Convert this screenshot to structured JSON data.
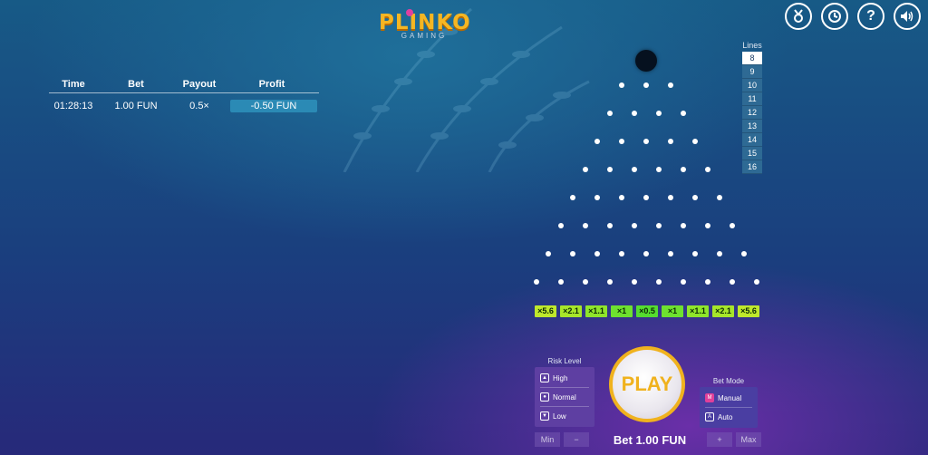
{
  "logo": {
    "word": "PLINKO",
    "sub": "GAMING"
  },
  "top_icons": [
    "medal-icon",
    "history-icon",
    "help-icon",
    "sound-icon"
  ],
  "history": {
    "headers": [
      "Time",
      "Bet",
      "Payout",
      "Profit"
    ],
    "rows": [
      {
        "time": "01:28:13",
        "bet": "1.00 FUN",
        "payout": "0.5×",
        "profit": "-0.50 FUN"
      }
    ]
  },
  "lines": {
    "label": "Lines",
    "options": [
      "8",
      "9",
      "10",
      "11",
      "12",
      "13",
      "14",
      "15",
      "16"
    ],
    "selected": "8"
  },
  "board": {
    "rows": 8,
    "multipliers": [
      "×5.6",
      "×2.1",
      "×1.1",
      "×1",
      "×0.5",
      "×1",
      "×1.1",
      "×2.1",
      "×5.6"
    ],
    "bucket_colors": [
      "#bfe82c",
      "#a7e62a",
      "#8fe52b",
      "#6ee12f",
      "#55dd2f",
      "#6ee12f",
      "#8fe52b",
      "#a7e62a",
      "#bfe82c"
    ]
  },
  "risk": {
    "label": "Risk Level",
    "options": [
      "High",
      "Normal",
      "Low"
    ]
  },
  "mode": {
    "label": "Bet Mode",
    "options": [
      {
        "key": "M",
        "label": "Manual"
      },
      {
        "key": "A",
        "label": "Auto"
      }
    ]
  },
  "play_label": "PLAY",
  "bet": {
    "label": "Bet 1.00 FUN",
    "min": "Min",
    "minus": "−",
    "plus": "+",
    "max": "Max"
  }
}
